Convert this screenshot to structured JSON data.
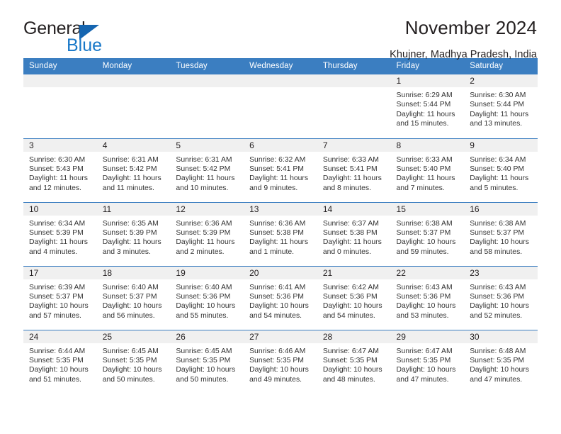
{
  "brand": {
    "name_part1": "General",
    "name_part2": "Blue",
    "triangle_color": "#1565b0",
    "blue_text_color": "#1878c8"
  },
  "header": {
    "title": "November 2024",
    "location": "Khujner, Madhya Pradesh, India"
  },
  "theme": {
    "header_row_bg": "#3b7ec1",
    "header_row_text": "#ffffff",
    "daynum_band_bg": "#f0f0f0",
    "cell_bg": "#ffffff",
    "grid_line": "#3b7ec1",
    "body_text": "#333333"
  },
  "calendar": {
    "weekday_headers": [
      "Sunday",
      "Monday",
      "Tuesday",
      "Wednesday",
      "Thursday",
      "Friday",
      "Saturday"
    ],
    "labels": {
      "sunrise": "Sunrise:",
      "sunset": "Sunset:",
      "daylight": "Daylight:"
    },
    "weeks": [
      [
        {
          "empty": true
        },
        {
          "empty": true
        },
        {
          "empty": true
        },
        {
          "empty": true
        },
        {
          "empty": true
        },
        {
          "day": "1",
          "sunrise": "Sunrise: 6:29 AM",
          "sunset": "Sunset: 5:44 PM",
          "daylight": "Daylight: 11 hours and 15 minutes."
        },
        {
          "day": "2",
          "sunrise": "Sunrise: 6:30 AM",
          "sunset": "Sunset: 5:44 PM",
          "daylight": "Daylight: 11 hours and 13 minutes."
        }
      ],
      [
        {
          "day": "3",
          "sunrise": "Sunrise: 6:30 AM",
          "sunset": "Sunset: 5:43 PM",
          "daylight": "Daylight: 11 hours and 12 minutes."
        },
        {
          "day": "4",
          "sunrise": "Sunrise: 6:31 AM",
          "sunset": "Sunset: 5:42 PM",
          "daylight": "Daylight: 11 hours and 11 minutes."
        },
        {
          "day": "5",
          "sunrise": "Sunrise: 6:31 AM",
          "sunset": "Sunset: 5:42 PM",
          "daylight": "Daylight: 11 hours and 10 minutes."
        },
        {
          "day": "6",
          "sunrise": "Sunrise: 6:32 AM",
          "sunset": "Sunset: 5:41 PM",
          "daylight": "Daylight: 11 hours and 9 minutes."
        },
        {
          "day": "7",
          "sunrise": "Sunrise: 6:33 AM",
          "sunset": "Sunset: 5:41 PM",
          "daylight": "Daylight: 11 hours and 8 minutes."
        },
        {
          "day": "8",
          "sunrise": "Sunrise: 6:33 AM",
          "sunset": "Sunset: 5:40 PM",
          "daylight": "Daylight: 11 hours and 7 minutes."
        },
        {
          "day": "9",
          "sunrise": "Sunrise: 6:34 AM",
          "sunset": "Sunset: 5:40 PM",
          "daylight": "Daylight: 11 hours and 5 minutes."
        }
      ],
      [
        {
          "day": "10",
          "sunrise": "Sunrise: 6:34 AM",
          "sunset": "Sunset: 5:39 PM",
          "daylight": "Daylight: 11 hours and 4 minutes."
        },
        {
          "day": "11",
          "sunrise": "Sunrise: 6:35 AM",
          "sunset": "Sunset: 5:39 PM",
          "daylight": "Daylight: 11 hours and 3 minutes."
        },
        {
          "day": "12",
          "sunrise": "Sunrise: 6:36 AM",
          "sunset": "Sunset: 5:39 PM",
          "daylight": "Daylight: 11 hours and 2 minutes."
        },
        {
          "day": "13",
          "sunrise": "Sunrise: 6:36 AM",
          "sunset": "Sunset: 5:38 PM",
          "daylight": "Daylight: 11 hours and 1 minute."
        },
        {
          "day": "14",
          "sunrise": "Sunrise: 6:37 AM",
          "sunset": "Sunset: 5:38 PM",
          "daylight": "Daylight: 11 hours and 0 minutes."
        },
        {
          "day": "15",
          "sunrise": "Sunrise: 6:38 AM",
          "sunset": "Sunset: 5:37 PM",
          "daylight": "Daylight: 10 hours and 59 minutes."
        },
        {
          "day": "16",
          "sunrise": "Sunrise: 6:38 AM",
          "sunset": "Sunset: 5:37 PM",
          "daylight": "Daylight: 10 hours and 58 minutes."
        }
      ],
      [
        {
          "day": "17",
          "sunrise": "Sunrise: 6:39 AM",
          "sunset": "Sunset: 5:37 PM",
          "daylight": "Daylight: 10 hours and 57 minutes."
        },
        {
          "day": "18",
          "sunrise": "Sunrise: 6:40 AM",
          "sunset": "Sunset: 5:37 PM",
          "daylight": "Daylight: 10 hours and 56 minutes."
        },
        {
          "day": "19",
          "sunrise": "Sunrise: 6:40 AM",
          "sunset": "Sunset: 5:36 PM",
          "daylight": "Daylight: 10 hours and 55 minutes."
        },
        {
          "day": "20",
          "sunrise": "Sunrise: 6:41 AM",
          "sunset": "Sunset: 5:36 PM",
          "daylight": "Daylight: 10 hours and 54 minutes."
        },
        {
          "day": "21",
          "sunrise": "Sunrise: 6:42 AM",
          "sunset": "Sunset: 5:36 PM",
          "daylight": "Daylight: 10 hours and 54 minutes."
        },
        {
          "day": "22",
          "sunrise": "Sunrise: 6:43 AM",
          "sunset": "Sunset: 5:36 PM",
          "daylight": "Daylight: 10 hours and 53 minutes."
        },
        {
          "day": "23",
          "sunrise": "Sunrise: 6:43 AM",
          "sunset": "Sunset: 5:36 PM",
          "daylight": "Daylight: 10 hours and 52 minutes."
        }
      ],
      [
        {
          "day": "24",
          "sunrise": "Sunrise: 6:44 AM",
          "sunset": "Sunset: 5:35 PM",
          "daylight": "Daylight: 10 hours and 51 minutes."
        },
        {
          "day": "25",
          "sunrise": "Sunrise: 6:45 AM",
          "sunset": "Sunset: 5:35 PM",
          "daylight": "Daylight: 10 hours and 50 minutes."
        },
        {
          "day": "26",
          "sunrise": "Sunrise: 6:45 AM",
          "sunset": "Sunset: 5:35 PM",
          "daylight": "Daylight: 10 hours and 50 minutes."
        },
        {
          "day": "27",
          "sunrise": "Sunrise: 6:46 AM",
          "sunset": "Sunset: 5:35 PM",
          "daylight": "Daylight: 10 hours and 49 minutes."
        },
        {
          "day": "28",
          "sunrise": "Sunrise: 6:47 AM",
          "sunset": "Sunset: 5:35 PM",
          "daylight": "Daylight: 10 hours and 48 minutes."
        },
        {
          "day": "29",
          "sunrise": "Sunrise: 6:47 AM",
          "sunset": "Sunset: 5:35 PM",
          "daylight": "Daylight: 10 hours and 47 minutes."
        },
        {
          "day": "30",
          "sunrise": "Sunrise: 6:48 AM",
          "sunset": "Sunset: 5:35 PM",
          "daylight": "Daylight: 10 hours and 47 minutes."
        }
      ]
    ]
  }
}
